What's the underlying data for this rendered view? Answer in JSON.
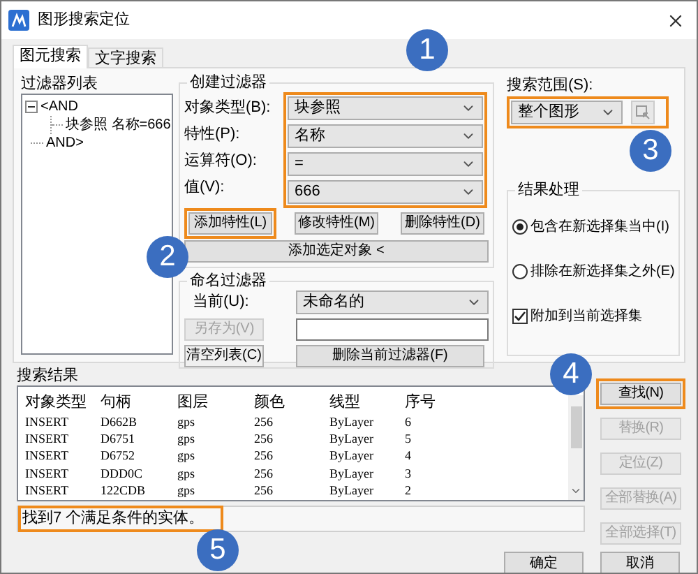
{
  "window": {
    "title": "图形搜索定位"
  },
  "tabs": [
    {
      "label": "图元搜索",
      "selected": true
    },
    {
      "label": "文字搜索",
      "selected": false
    }
  ],
  "filter_list": {
    "label": "过滤器列表",
    "tree": [
      {
        "label": "<AND",
        "expanded": true,
        "children": [
          {
            "label": "块参照 名称=666"
          }
        ]
      },
      {
        "label": "AND>"
      }
    ]
  },
  "create_filter": {
    "title": "创建过滤器",
    "fields_highlighted": true,
    "fields": [
      {
        "label": "对象类型(B):",
        "value": "块参照"
      },
      {
        "label": "特性(P):",
        "value": "名称"
      },
      {
        "label": "运算符(O):",
        "value": "="
      },
      {
        "label": "值(V):",
        "value": "666"
      }
    ],
    "buttons": [
      {
        "label": "添加特性(L)",
        "highlighted": true
      },
      {
        "label": "修改特性(M)",
        "highlighted": false
      },
      {
        "label": "删除特性(D)",
        "highlighted": false
      }
    ],
    "add_selected": "添加选定对象 <"
  },
  "named_filter": {
    "title": "命名过滤器",
    "current_label": "当前(U):",
    "current_value": "未命名的",
    "save_as": {
      "label": "另存为(V)",
      "disabled": true
    },
    "clear": "清空列表(C)",
    "delete": "删除当前过滤器(F)"
  },
  "search_range": {
    "label": "搜索范围(S):",
    "value": "整个图形",
    "highlighted": true
  },
  "result_handling": {
    "title": "结果处理",
    "options": [
      {
        "label": "包含在新选择集当中(I)",
        "selected": true
      },
      {
        "label": "排除在新选择集之外(E)",
        "selected": false
      }
    ],
    "append": {
      "label": "附加到当前选择集",
      "checked": true
    }
  },
  "results": {
    "label": "搜索结果",
    "columns": [
      "对象类型",
      "句柄",
      "图层",
      "颜色",
      "线型",
      "序号"
    ],
    "rows": [
      [
        "INSERT",
        "D662B",
        "gps",
        "256",
        "ByLayer",
        "6"
      ],
      [
        "INSERT",
        "D6751",
        "gps",
        "256",
        "ByLayer",
        "5"
      ],
      [
        "INSERT",
        "D6752",
        "gps",
        "256",
        "ByLayer",
        "4"
      ],
      [
        "INSERT",
        "DDD0C",
        "gps",
        "256",
        "ByLayer",
        "3"
      ],
      [
        "INSERT",
        "122CDB",
        "gps",
        "256",
        "ByLayer",
        "2"
      ]
    ],
    "status": "找到7 个满足条件的实体。",
    "status_highlighted": true
  },
  "actions": [
    {
      "label": "查找(N)",
      "disabled": false,
      "highlighted": true
    },
    {
      "label": "替换(R)",
      "disabled": true,
      "highlighted": false
    },
    {
      "label": "定位(Z)",
      "disabled": true,
      "highlighted": false
    },
    {
      "label": "全部替换(A)",
      "disabled": true,
      "highlighted": false
    },
    {
      "label": "全部选择(T)",
      "disabled": true,
      "highlighted": false
    }
  ],
  "footer": [
    "确定",
    "取消"
  ],
  "callouts": [
    "1",
    "2",
    "3",
    "4",
    "5"
  ]
}
